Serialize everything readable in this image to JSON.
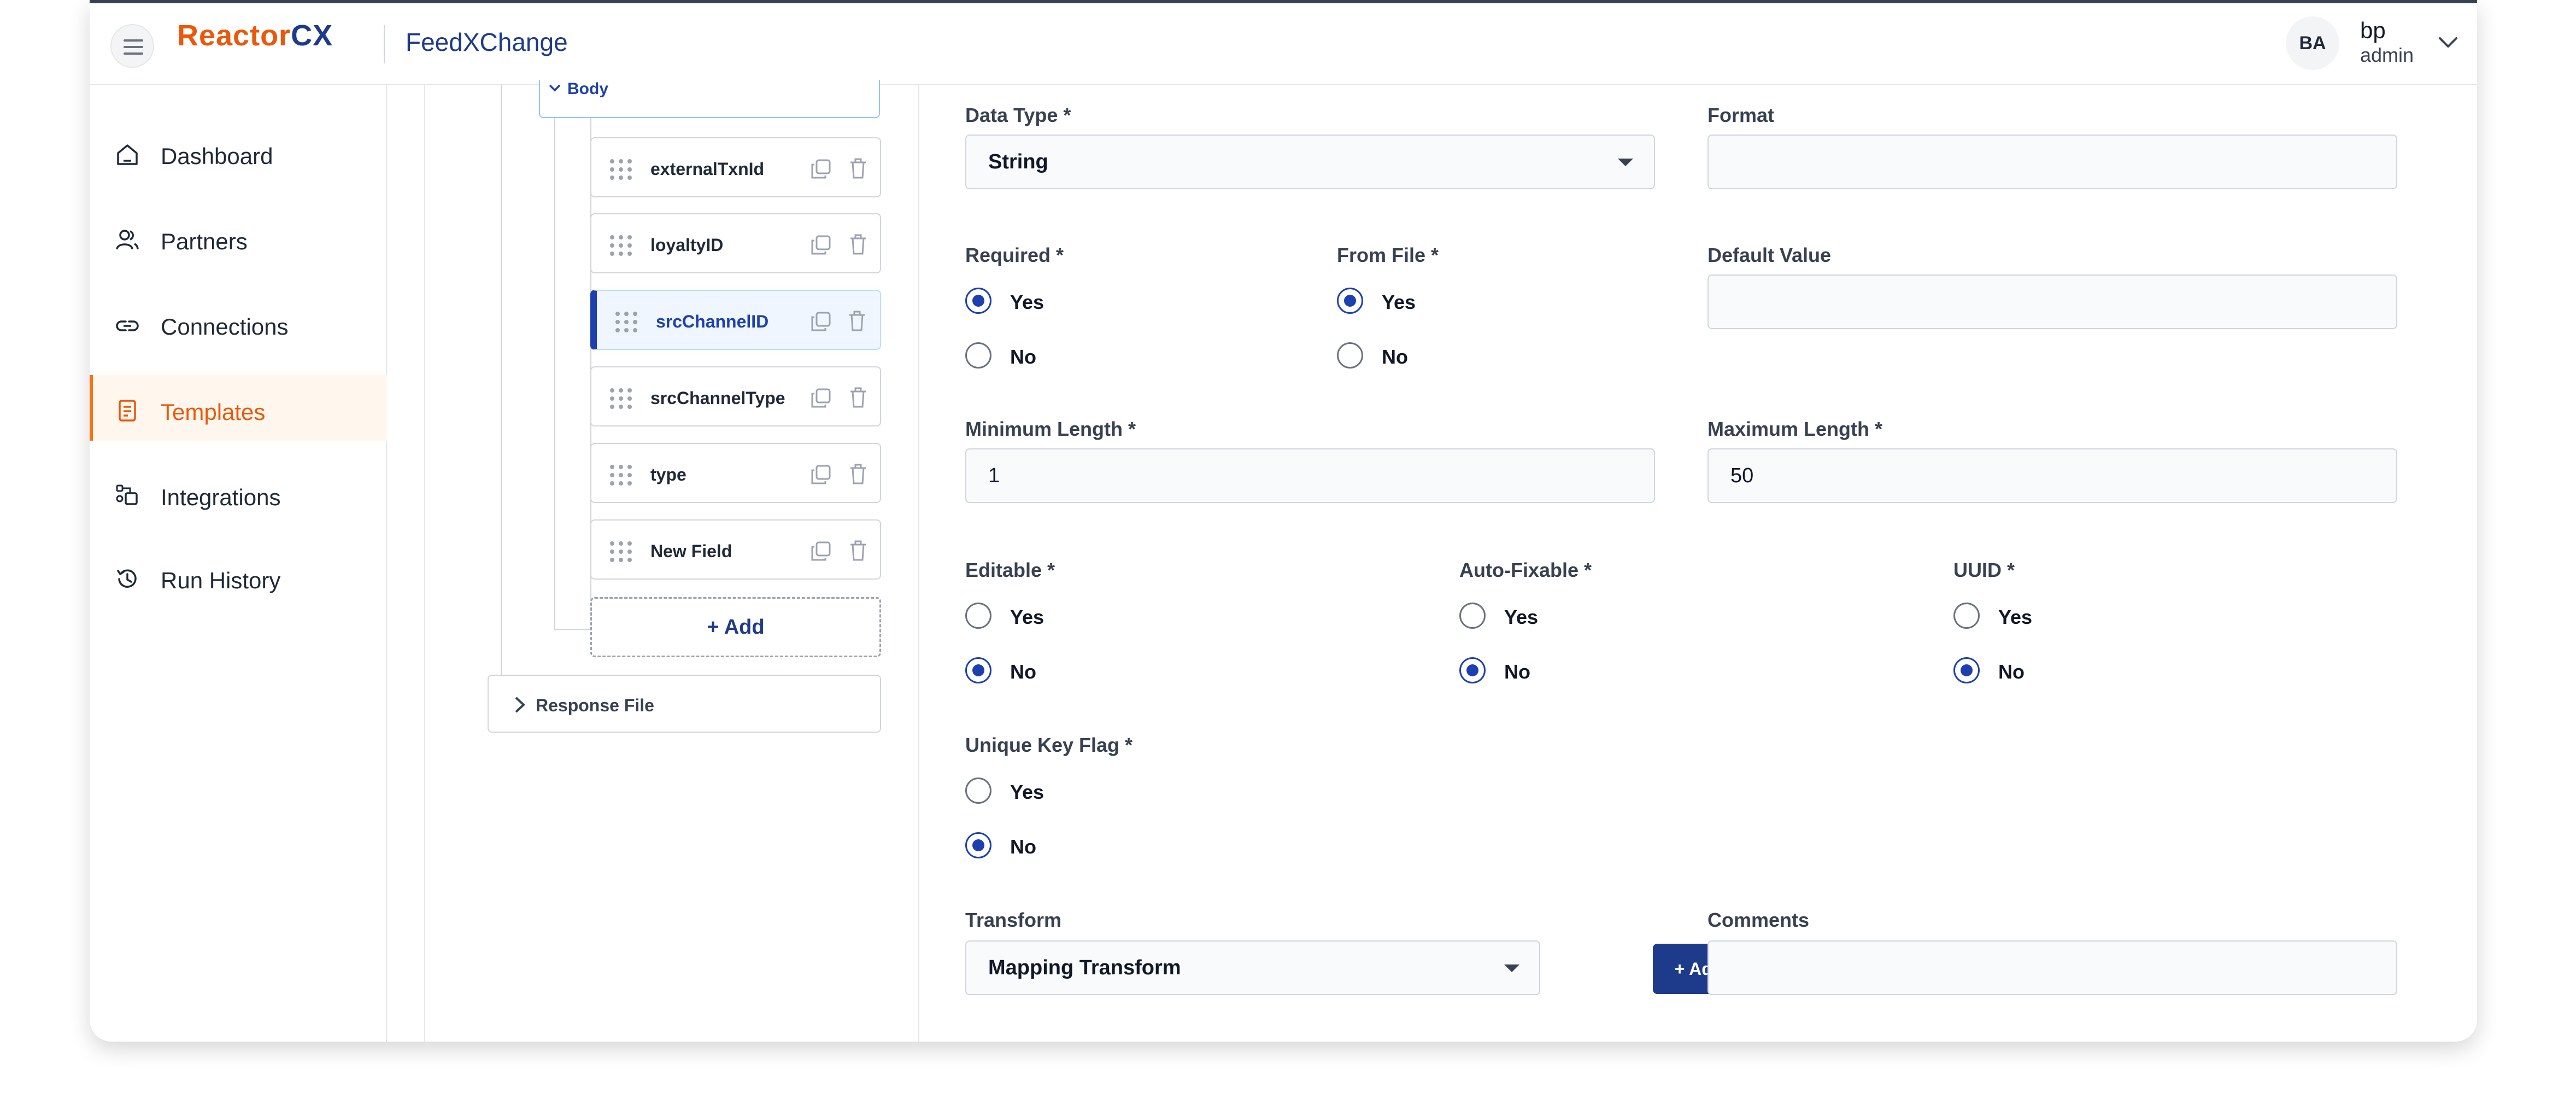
{
  "header": {
    "logo_main": "Reactor",
    "logo_accent": "CX",
    "app_title": "FeedXChange",
    "avatar": "BA",
    "user_name": "bp",
    "user_role": "admin"
  },
  "sidebar": {
    "items": [
      {
        "label": "Dashboard",
        "icon": "home-icon"
      },
      {
        "label": "Partners",
        "icon": "users-icon"
      },
      {
        "label": "Connections",
        "icon": "link-icon"
      },
      {
        "label": "Templates",
        "icon": "document-icon",
        "active": true
      },
      {
        "label": "Integrations",
        "icon": "integrations-icon"
      },
      {
        "label": "Run History",
        "icon": "history-icon"
      }
    ]
  },
  "tree": {
    "body_label": "Body",
    "fields": [
      "externalTxnId",
      "loyaltyID",
      "srcChannelID",
      "srcChannelType",
      "type",
      "New Field"
    ],
    "selected": "srcChannelID",
    "add_label": "Add",
    "response_label": "Response File"
  },
  "form": {
    "data_type": {
      "label": "Data Type *",
      "value": "String"
    },
    "format": {
      "label": "Format",
      "value": ""
    },
    "required": {
      "label": "Required *",
      "yes": "Yes",
      "no": "No",
      "selected": "Yes"
    },
    "from_file": {
      "label": "From File *",
      "yes": "Yes",
      "no": "No",
      "selected": "Yes"
    },
    "default_value": {
      "label": "Default Value",
      "value": ""
    },
    "min_length": {
      "label": "Minimum Length *",
      "value": "1"
    },
    "max_length": {
      "label": "Maximum Length *",
      "value": "50"
    },
    "editable": {
      "label": "Editable *",
      "yes": "Yes",
      "no": "No",
      "selected": "No"
    },
    "auto_fixable": {
      "label": "Auto-Fixable *",
      "yes": "Yes",
      "no": "No",
      "selected": "No"
    },
    "uuid": {
      "label": "UUID *",
      "yes": "Yes",
      "no": "No",
      "selected": "No"
    },
    "unique_key": {
      "label": "Unique Key Flag *",
      "yes": "Yes",
      "no": "No",
      "selected": "No"
    },
    "transform": {
      "label": "Transform",
      "value": "Mapping Transform",
      "add_label": "Add"
    },
    "comments": {
      "label": "Comments",
      "value": ""
    }
  },
  "colors": {
    "brand": "#ea580c",
    "primary": "#1e3a8a",
    "active_bg": "#fff7ed"
  }
}
